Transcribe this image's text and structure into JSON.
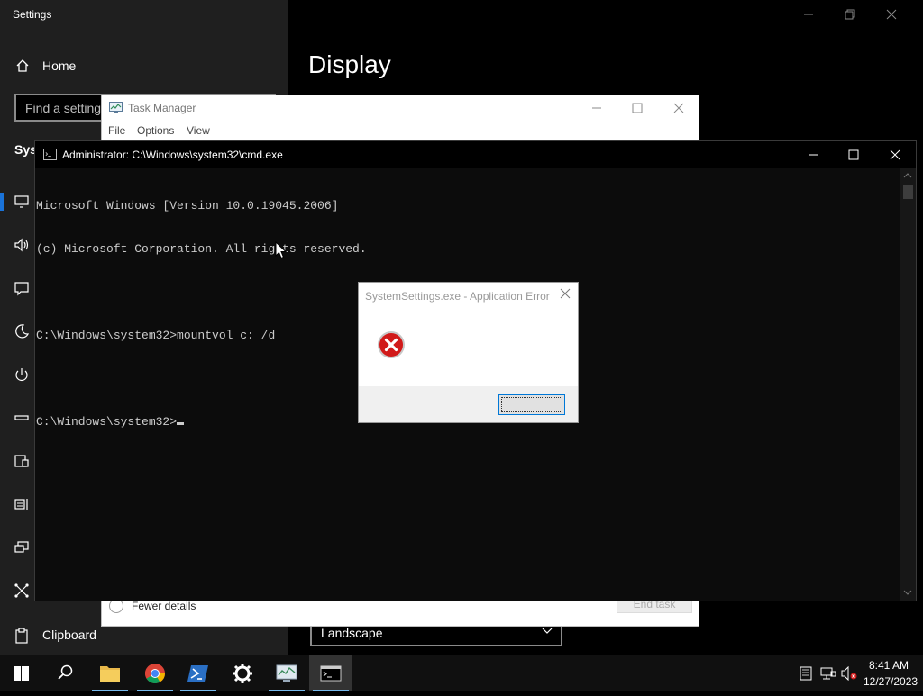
{
  "settings": {
    "window_title": "Settings",
    "home_label": "Home",
    "search_placeholder": "Find a setting",
    "section_label": "System",
    "page_title": "Display",
    "nav_clipboard_label": "Clipboard",
    "orientation_value": "Landscape"
  },
  "task_manager": {
    "title": "Task Manager",
    "menu": [
      "File",
      "Options",
      "View"
    ],
    "fewer_details": "Fewer details",
    "end_task": "End task"
  },
  "cmd": {
    "title": "Administrator: C:\\Windows\\system32\\cmd.exe",
    "lines": [
      "Microsoft Windows [Version 10.0.19045.2006]",
      "(c) Microsoft Corporation. All rights reserved.",
      "",
      "C:\\Windows\\system32>mountvol c: /d",
      "",
      "C:\\Windows\\system32>"
    ]
  },
  "error_dialog": {
    "title": "SystemSettings.exe - Application Error",
    "ok_label": ""
  },
  "taskbar": {
    "time": "8:41 AM",
    "date": "12/27/2023",
    "accent": "#76b9ed"
  }
}
